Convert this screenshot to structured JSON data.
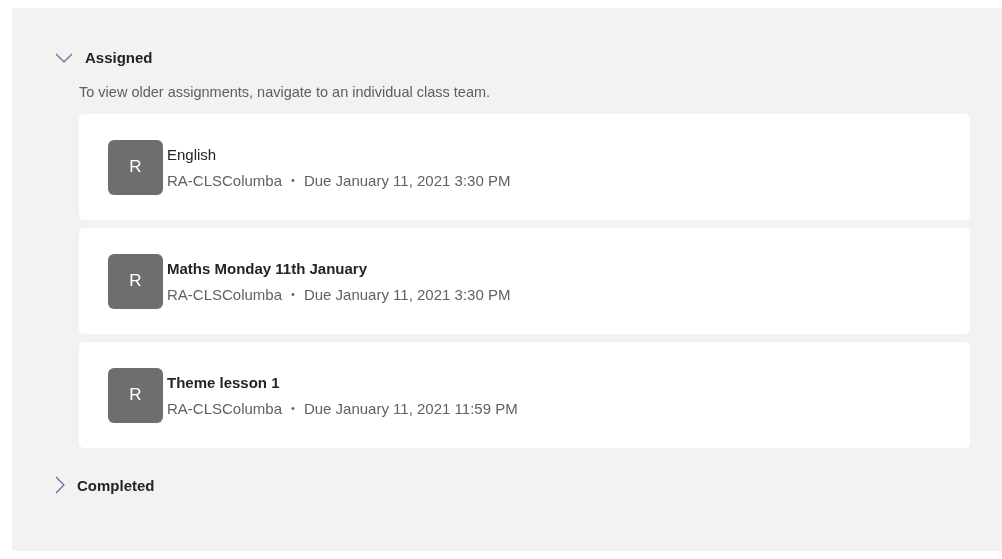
{
  "sections": [
    {
      "title": "Assigned",
      "expanded": true,
      "note": "To view older assignments, navigate to an individual class team.",
      "assignments": [
        {
          "avatar": "R",
          "title": "English",
          "unread": false,
          "team": "RA-CLSColumba",
          "separator": "•",
          "due": "Due January 11, 2021 3:30 PM"
        },
        {
          "avatar": "R",
          "title": "Maths Monday 11th January",
          "unread": true,
          "team": "RA-CLSColumba",
          "separator": "•",
          "due": "Due January 11, 2021 3:30 PM"
        },
        {
          "avatar": "R",
          "title": "Theme lesson 1",
          "unread": true,
          "team": "RA-CLSColumba",
          "separator": "•",
          "due": "Due January 11, 2021 11:59 PM"
        }
      ]
    },
    {
      "title": "Completed",
      "expanded": false
    }
  ]
}
